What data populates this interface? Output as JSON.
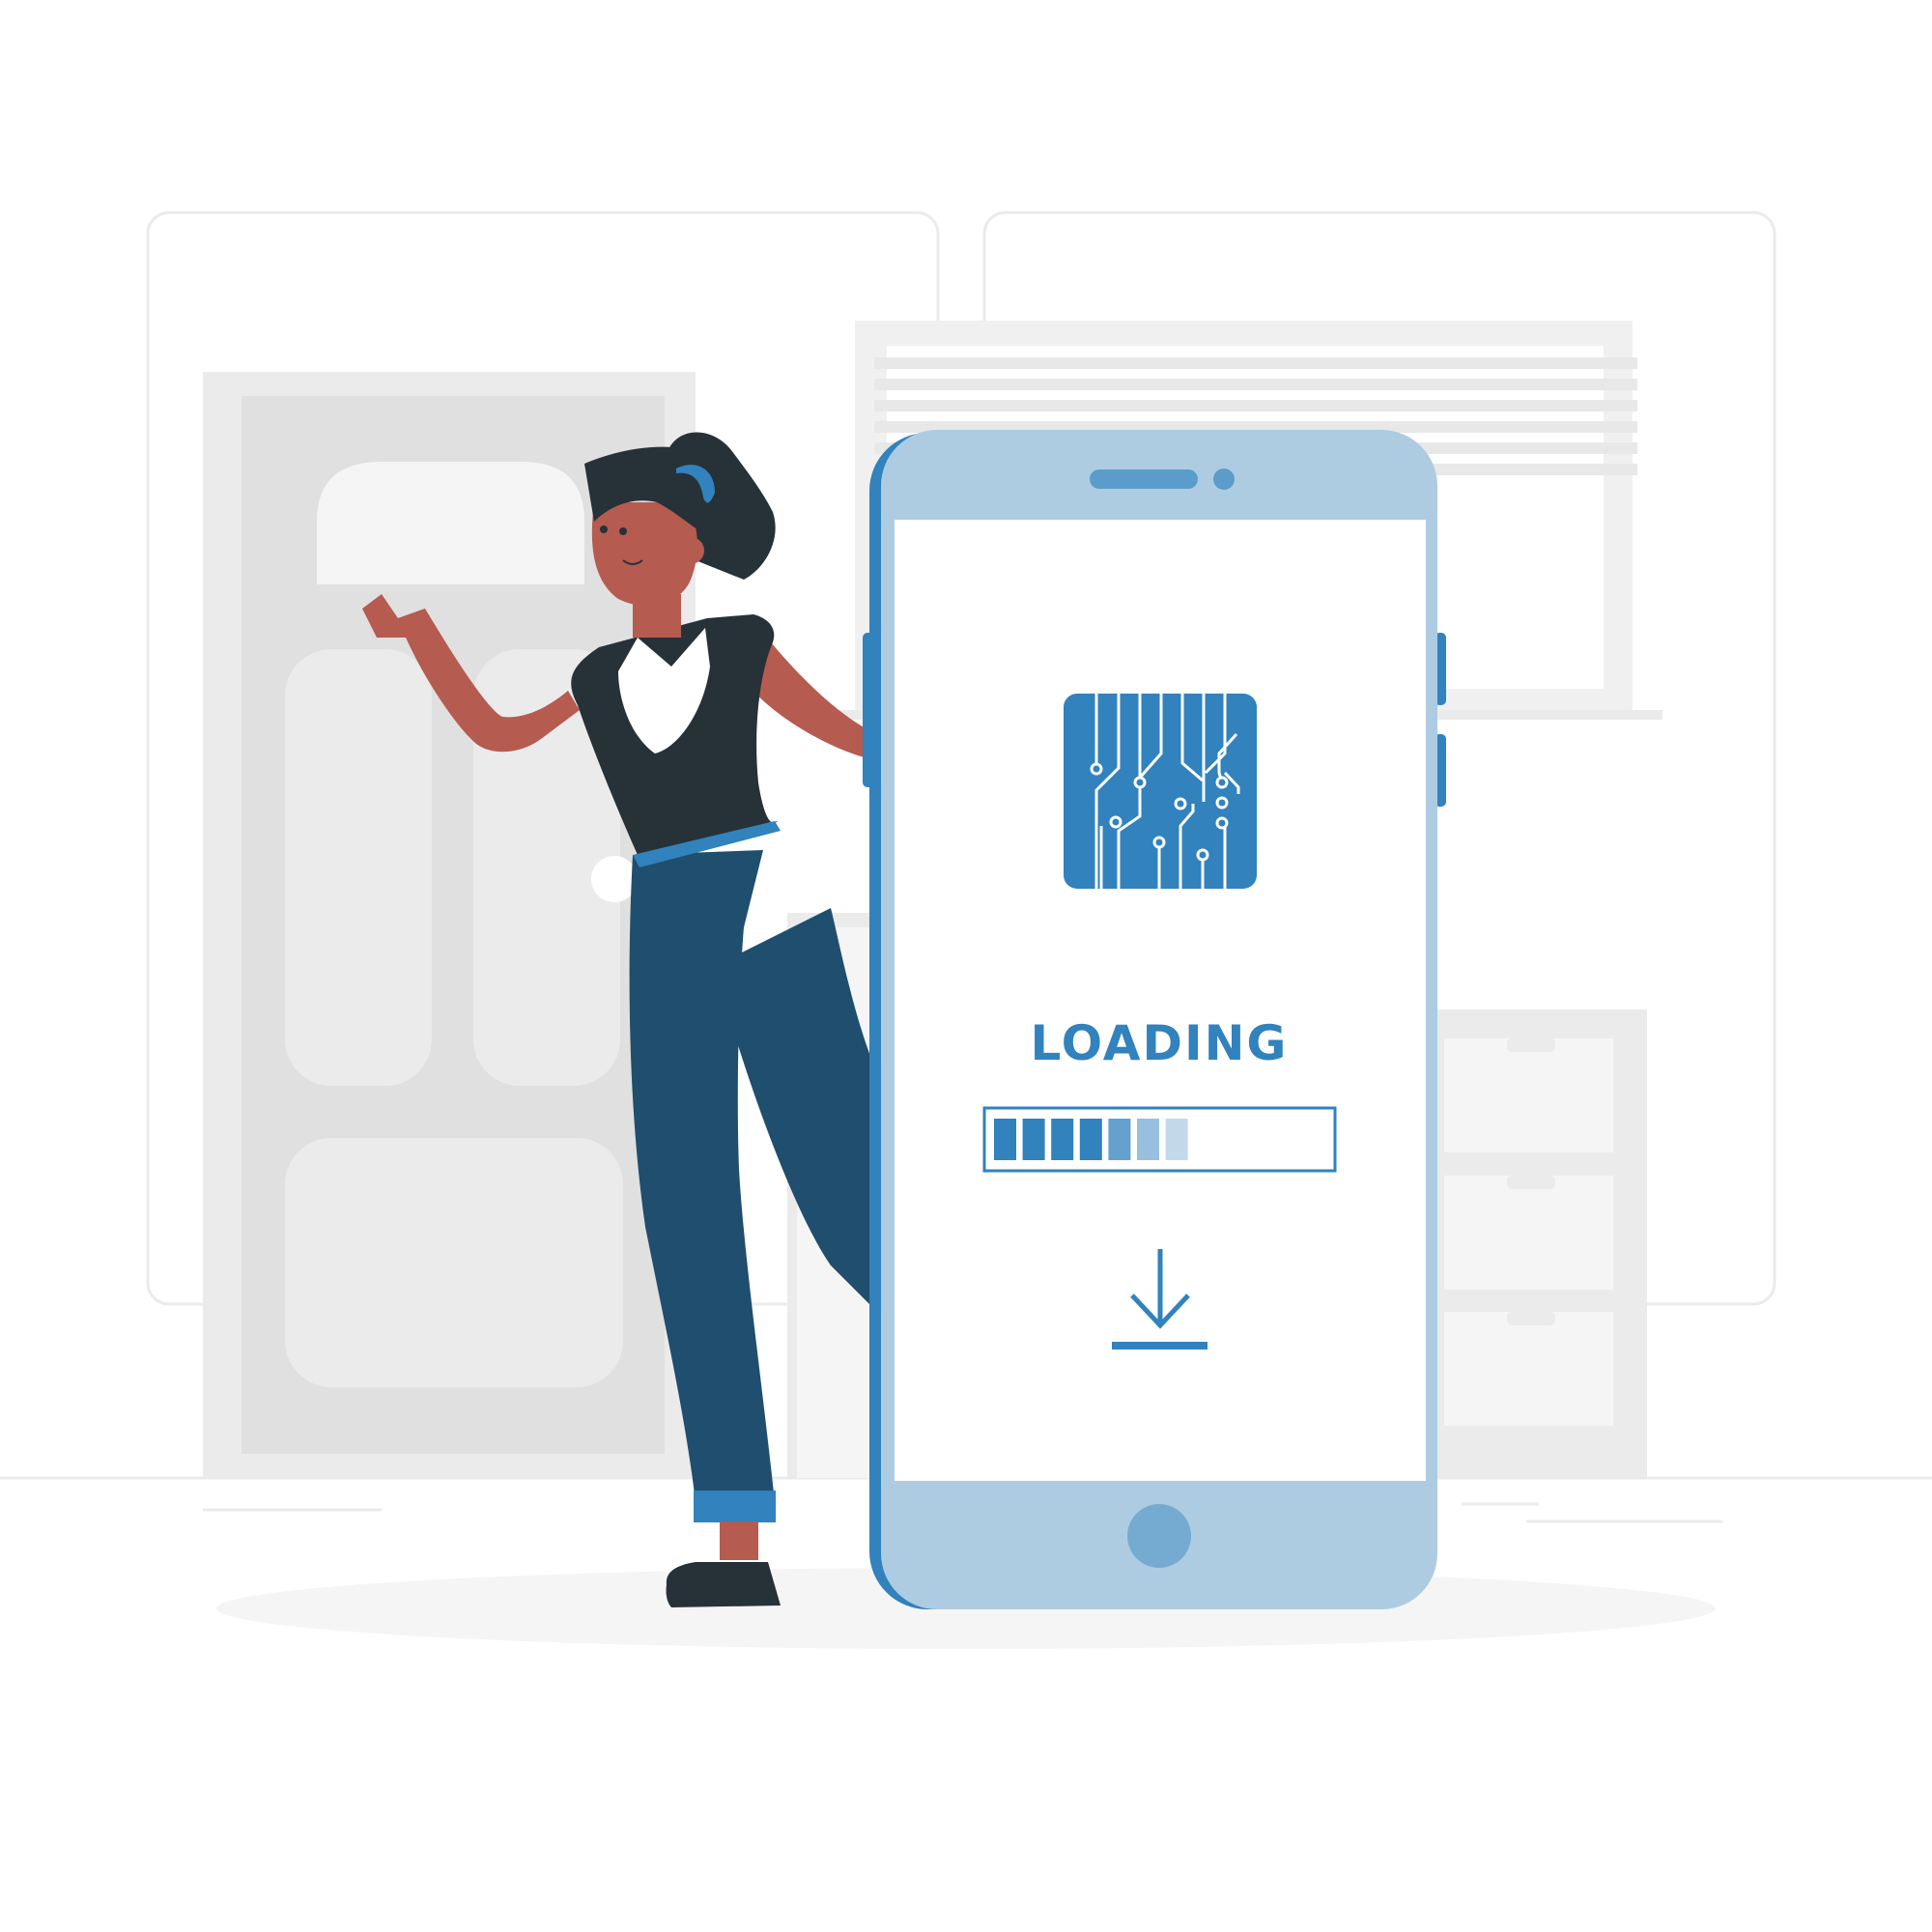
{
  "screen": {
    "loading_label": "LOADING",
    "progress": {
      "segments_total": 11,
      "segments_shown": 7
    }
  },
  "icons": {
    "chip": "circuit-chip-icon",
    "download": "download-icon"
  },
  "colors": {
    "accent": "#3182bd",
    "phone_body": "#adcce2",
    "hair_shirt": "#263238",
    "jeans": "#1f4e6e",
    "skin": "#b55b50",
    "background_shapes": "#f0f0f0"
  }
}
